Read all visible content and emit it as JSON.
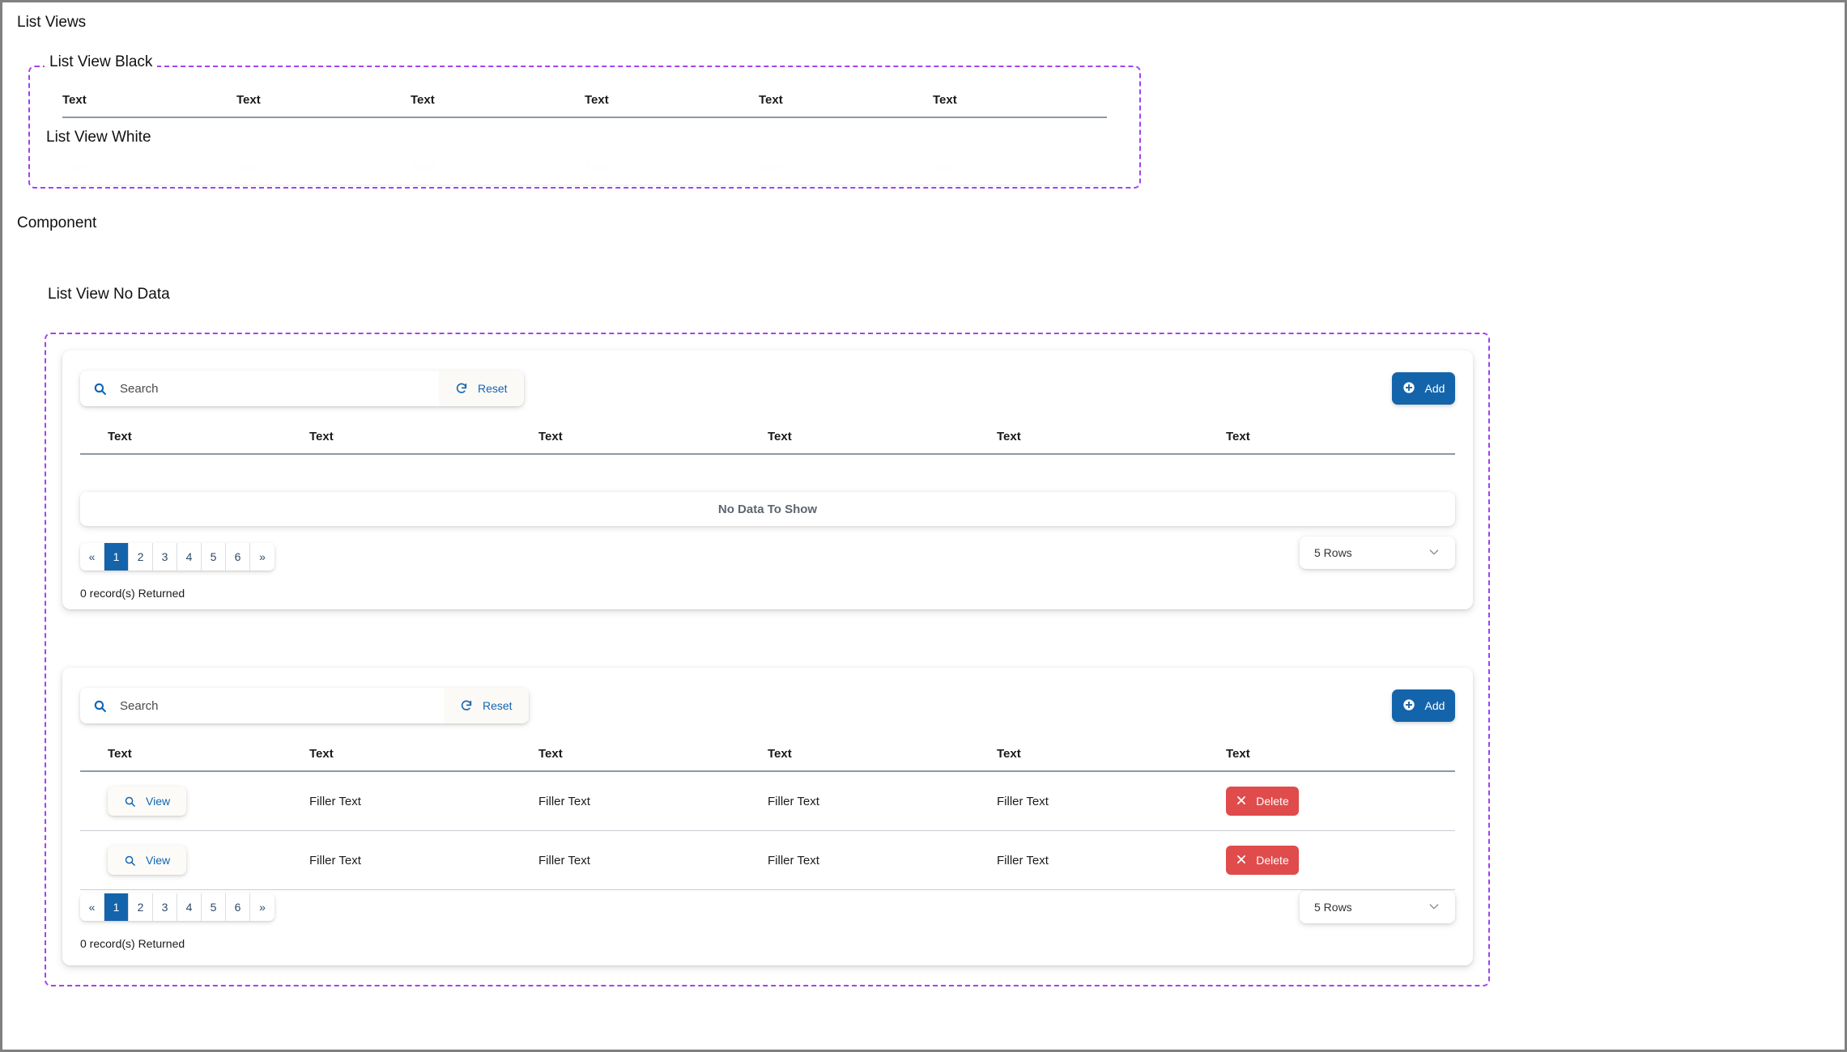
{
  "page": {
    "title": "List Views",
    "component_label": "Component"
  },
  "black_section": {
    "label": "List View Black",
    "columns": [
      "Text",
      "Text",
      "Text",
      "Text",
      "Text",
      "Text"
    ]
  },
  "white_section": {
    "label": "List View White",
    "columns": [
      "Text",
      "Text",
      "Text",
      "Text",
      "Text",
      "Text"
    ]
  },
  "no_data_section": {
    "label": "List View No Data"
  },
  "list_empty": {
    "search": {
      "placeholder": "Search",
      "value": ""
    },
    "reset_label": "Reset",
    "add_label": "Add",
    "columns": [
      "Text",
      "Text",
      "Text",
      "Text",
      "Text",
      "Text"
    ],
    "empty_message": "No Data To Show",
    "pagination": {
      "prev": "«",
      "pages": [
        "1",
        "2",
        "3",
        "4",
        "5",
        "6"
      ],
      "next": "»",
      "active": "1"
    },
    "records_text": "0 record(s) Returned",
    "rows_select": {
      "value": "5 Rows"
    }
  },
  "list_data": {
    "search": {
      "placeholder": "Search",
      "value": ""
    },
    "reset_label": "Reset",
    "add_label": "Add",
    "columns": [
      "Text",
      "Text",
      "Text",
      "Text",
      "Text",
      "Text"
    ],
    "view_label": "View",
    "delete_label": "Delete",
    "rows": [
      {
        "c2": "Filler Text",
        "c3": "Filler Text",
        "c4": "Filler Text",
        "c5": "Filler Text"
      },
      {
        "c2": "Filler Text",
        "c3": "Filler Text",
        "c4": "Filler Text",
        "c5": "Filler Text"
      }
    ],
    "pagination": {
      "prev": "«",
      "pages": [
        "1",
        "2",
        "3",
        "4",
        "5",
        "6"
      ],
      "next": "»",
      "active": "1"
    },
    "records_text": "0 record(s) Returned",
    "rows_select": {
      "value": "5 Rows"
    }
  },
  "colors": {
    "accent_blue": "#1464ab",
    "danger_red": "#e04b4b",
    "dashed_purple": "#a342f0"
  }
}
